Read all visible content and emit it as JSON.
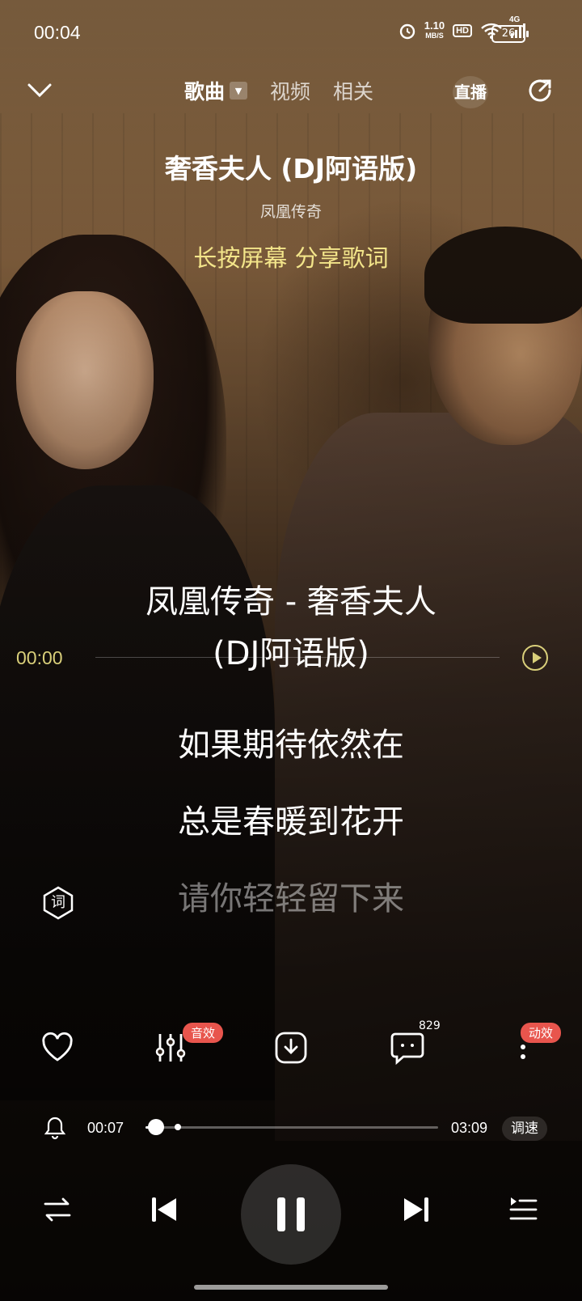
{
  "status_bar": {
    "time": "00:04",
    "net_speed_value": "1.10",
    "net_speed_unit": "MB/S",
    "hd": "HD",
    "signal": "4G",
    "battery": "26"
  },
  "nav": {
    "tabs": [
      {
        "label": "歌曲",
        "active": true
      },
      {
        "label": "视频",
        "active": false
      },
      {
        "label": "相关",
        "active": false
      }
    ],
    "live_label": "直播"
  },
  "song": {
    "title": "奢香夫人 (DJ阿语版)",
    "artist": "凤凰传奇",
    "share_tip": "长按屏幕 分享歌词"
  },
  "lyrics": {
    "header_line1": "凤凰传奇 - 奢香夫人",
    "header_line2": "(DJ阿语版)",
    "seek_time": "00:00",
    "lines": [
      "如果期待依然在",
      "总是春暖到花开",
      "请你轻轻留下来"
    ],
    "lyric_button": "词"
  },
  "actions": {
    "sound_effect_badge": "音效",
    "comment_count": "829",
    "dynamic_effect_badge": "动效"
  },
  "playback": {
    "current_time": "00:07",
    "duration": "03:09",
    "progress_fraction": 0.037,
    "speed_label": "调速"
  },
  "colors": {
    "accent_yellow": "#f3e58a",
    "badge_red": "#e8554d",
    "lyric_time": "#d9cf7a"
  },
  "icons": [
    "chevron-down-icon",
    "dropdown-icon",
    "live-icon",
    "share-icon",
    "play-icon",
    "lyric-icon",
    "heart-icon",
    "equalizer-icon",
    "download-icon",
    "comment-icon",
    "more-icon",
    "alarm-icon",
    "repeat-icon",
    "previous-icon",
    "pause-icon",
    "next-icon",
    "playlist-icon"
  ]
}
